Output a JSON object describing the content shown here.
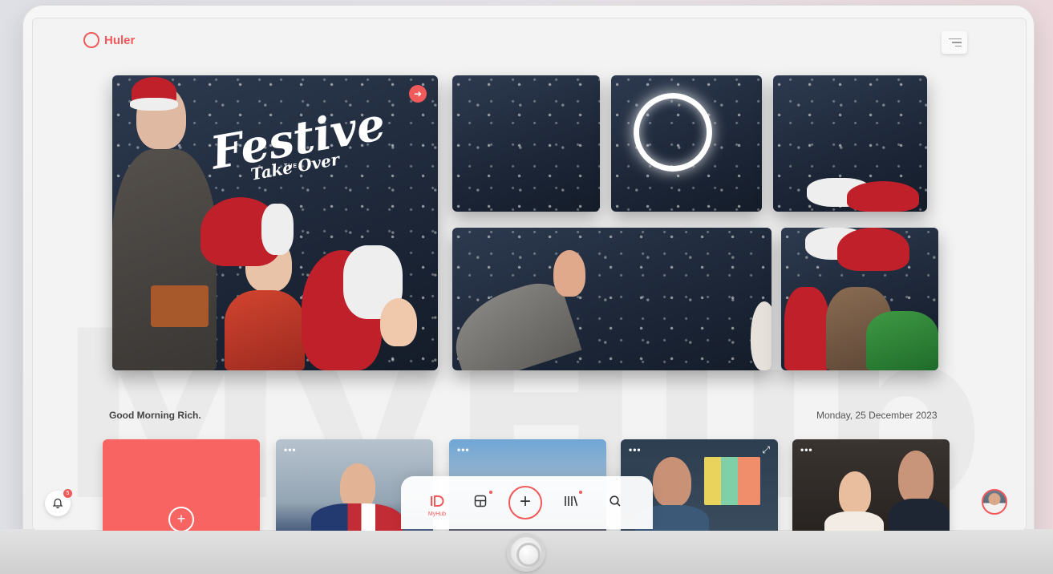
{
  "app": {
    "brand": "Huler",
    "watermark": "MyHub"
  },
  "hero": {
    "featured": {
      "eyebrow": "THE",
      "title": "Festive",
      "subtitle": "Take Over"
    }
  },
  "greeting": "Good Morning Rich.",
  "date": "Monday, 25 December 2023",
  "cards": [
    {
      "type": "add",
      "icon": "plus-icon"
    },
    {
      "type": "media",
      "menu": "•••",
      "expand": "⤢"
    },
    {
      "type": "media",
      "menu": "•••",
      "expand": "⤢"
    },
    {
      "type": "media",
      "menu": "•••",
      "expand": "⤢"
    },
    {
      "type": "media",
      "menu": "•••",
      "expand": "⤢"
    }
  ],
  "nav": {
    "items": [
      {
        "label": "MyHub",
        "icon": "myhub-icon"
      },
      {
        "label": "",
        "icon": "layout-icon"
      },
      {
        "label": "",
        "icon": "plus-icon"
      },
      {
        "label": "",
        "icon": "library-icon"
      },
      {
        "label": "",
        "icon": "search-icon"
      }
    ]
  },
  "notifications": {
    "count": "5"
  },
  "colors": {
    "accent": "#f05a5a",
    "add_card": "#f86462"
  }
}
